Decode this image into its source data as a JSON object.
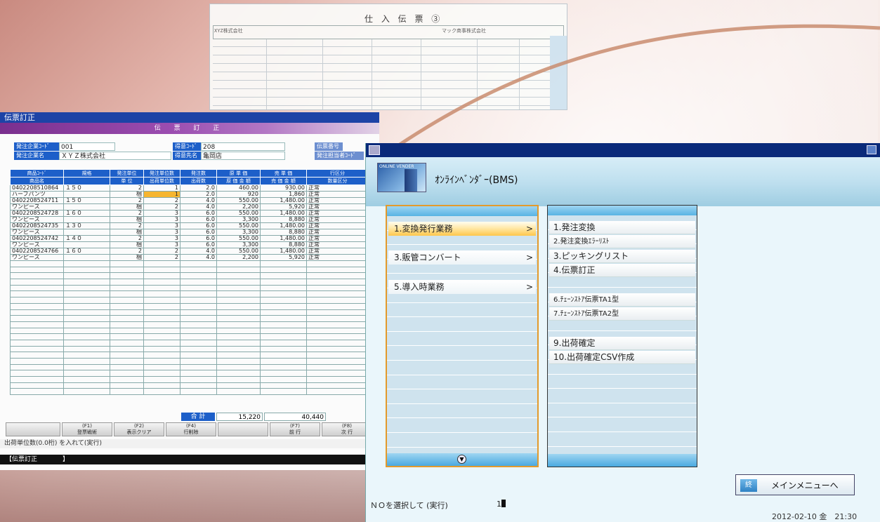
{
  "paper": {
    "title": "仕 入 伝 票 ③",
    "company": "XYZ株式会社",
    "vendor": "マック商事株式会社"
  },
  "left_window": {
    "title": "伝票訂正",
    "subtitle": "伝 票 訂 正",
    "info": {
      "order_company_code_label": "発注企業ｺｰﾄﾞ",
      "order_company_code": "001",
      "order_company_name_label": "発注企業名",
      "order_company_name": "ＸＹＺ株式会社",
      "store_code_label": "得意ｺｰﾄﾞ",
      "store_code": "208",
      "store_name_label": "得意先名",
      "store_name": "亀岡店",
      "slip_no_label": "伝票番号",
      "classification_label": "発注担当者ｺｰﾄﾞ"
    },
    "headers_top": [
      "商品ｺｰﾄﾞ",
      "規格",
      "発注単位",
      "発注単位数",
      "発注数",
      "原 単 価",
      "売 単 価",
      "行区分"
    ],
    "headers_bottom": [
      "商品名",
      "",
      "単 位",
      "出荷単位数",
      "出荷数",
      "原 価 金 額",
      "売 価 金 額",
      "数量区分"
    ],
    "rows": [
      [
        "0402208510864",
        "１５０",
        "2",
        "1",
        "2.0",
        "460.00",
        "930.00",
        "正常"
      ],
      [
        "ハーフパンツ",
        "",
        "梱",
        "1",
        "2.0",
        "920",
        "1,860",
        "正常"
      ],
      [
        "0402208524711",
        "１５０",
        "2",
        "2",
        "4.0",
        "550.00",
        "1,480.00",
        "正常"
      ],
      [
        "ワンピース",
        "",
        "梱",
        "2",
        "4.0",
        "2,200",
        "5,920",
        "正常"
      ],
      [
        "0402208524728",
        "１６０",
        "2",
        "3",
        "6.0",
        "550.00",
        "1,480.00",
        "正常"
      ],
      [
        "ワンピース",
        "",
        "梱",
        "3",
        "6.0",
        "3,300",
        "8,880",
        "正常"
      ],
      [
        "0402208524735",
        "１３０",
        "2",
        "3",
        "6.0",
        "550.00",
        "1,480.00",
        "正常"
      ],
      [
        "ワンピース",
        "",
        "梱",
        "3",
        "6.0",
        "3,300",
        "8,880",
        "正常"
      ],
      [
        "0402208524742",
        "１４０",
        "2",
        "3",
        "6.0",
        "550.00",
        "1,480.00",
        "正常"
      ],
      [
        "ワンピース",
        "",
        "梱",
        "3",
        "6.0",
        "3,300",
        "8,880",
        "正常"
      ],
      [
        "0402208524766",
        "１６０",
        "2",
        "2",
        "4.0",
        "550.00",
        "1,480.00",
        "正常"
      ],
      [
        "ワンピース",
        "",
        "梱",
        "2",
        "4.0",
        "2,200",
        "5,920",
        "正常"
      ]
    ],
    "total_label": "合 計",
    "total_cost": "15,220",
    "total_sales": "40,440",
    "fkeys": [
      {
        "key": "",
        "label": ""
      },
      {
        "key": "(F1)",
        "label": "登票戦術"
      },
      {
        "key": "(F2)",
        "label": "表示クリア"
      },
      {
        "key": "(F4)",
        "label": "行削除"
      },
      {
        "key": "",
        "label": ""
      },
      {
        "key": "(F7)",
        "label": "前 行"
      },
      {
        "key": "(F8)",
        "label": "次 行"
      }
    ],
    "status_message": "出荷単位数(0.0桁) を入れて(実行)",
    "bottom_bar": "【伝票訂正　　　　】"
  },
  "right_window": {
    "title": "ｵﾝﾗｲﾝﾍﾞﾝﾀﾞｰ(BMS)",
    "logo_text": "ONLINE VENDER",
    "menu_left": [
      {
        "label": "1.変換発行業務",
        "arrow": ">"
      },
      {
        "label": "3.販管コンバート",
        "arrow": ">"
      },
      {
        "label": "5.導入時業務",
        "arrow": ">"
      }
    ],
    "menu_right": [
      "1.発注変換",
      "2.発注変換ｴﾗｰﾘｽﾄ",
      "3.ピッキングリスト",
      "4.伝票訂正",
      "6.ﾁｪｰﾝｽﾄｱ伝票TA1型",
      "7.ﾁｪｰﾝｽﾄｱ伝票TA2型",
      "9.出荷確定",
      "10.出荷確定CSV作成"
    ],
    "main_menu_key": "終",
    "main_menu_label": "メインメニューへ",
    "prompt": "ＮＯを選択して (実行)",
    "input_value": "1",
    "datetime": "2012-02-10 金　21:30"
  },
  "colors": {
    "accent_blue": "#1d5fc9",
    "title_purple": "#7a2f8e",
    "selection_orange": "#e39a2b",
    "menu_bg": "#cfe3ee"
  }
}
